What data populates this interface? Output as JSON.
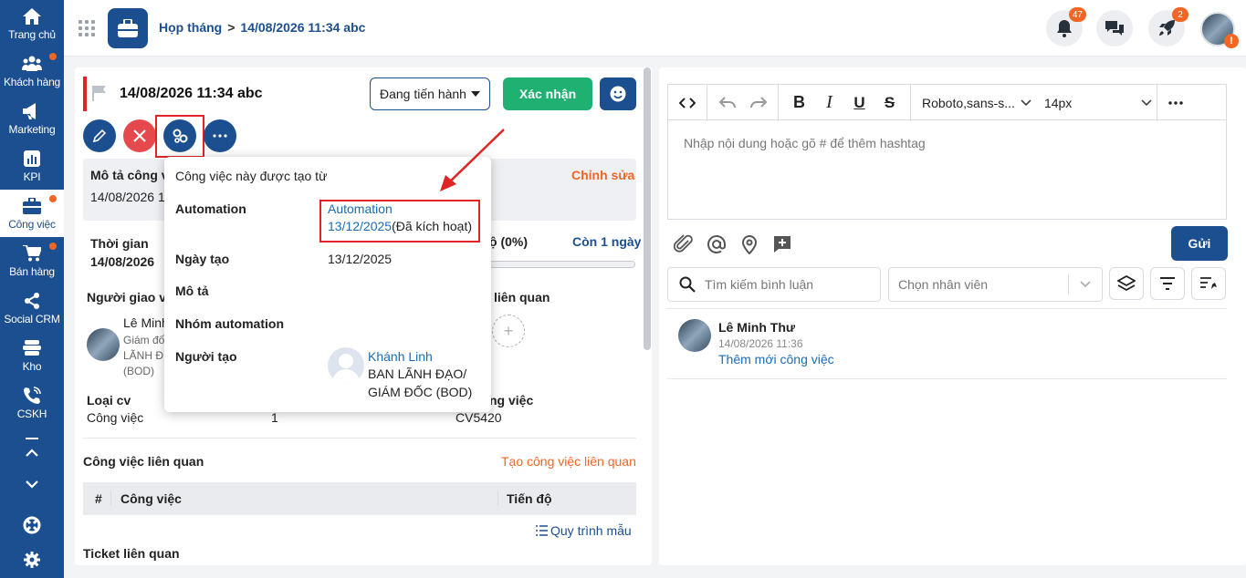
{
  "sidebar": {
    "items": [
      {
        "label": "Trang chủ",
        "icon": "home-icon"
      },
      {
        "label": "Khách hàng",
        "icon": "users-icon"
      },
      {
        "label": "Marketing",
        "icon": "megaphone-icon"
      },
      {
        "label": "KPI",
        "icon": "chart-icon"
      },
      {
        "label": "Công việc",
        "icon": "briefcase-icon"
      },
      {
        "label": "Bán hàng",
        "icon": "cart-icon"
      },
      {
        "label": "Social CRM",
        "icon": "share-icon"
      },
      {
        "label": "Kho",
        "icon": "warehouse-icon"
      },
      {
        "label": "CSKH",
        "icon": "phone-icon"
      }
    ]
  },
  "header": {
    "breadcrumb_parent": "Họp tháng",
    "breadcrumb_sep": ">",
    "breadcrumb_current": "14/08/2026 11:34 abc",
    "notif_count": "47",
    "rocket_count": "2",
    "warn_symbol": "!"
  },
  "task": {
    "title": "14/08/2026 11:34 abc",
    "status": "Đang tiến hành",
    "confirm_label": "Xác nhận",
    "desc_label": "Mô tả công v",
    "desc_value": "14/08/2026 1",
    "edit_link": "Chỉnh sửa",
    "time_label": "Thời gian",
    "time_value": "14/08/2026",
    "progress_label": "ộ (0%)",
    "progress_value": 0,
    "remaining": "Còn 1 ngày",
    "assigner_label": "Người giao vi",
    "related_label": "liên quan",
    "assigner_name": "Lê Minh",
    "assigner_role1": "Giám đố",
    "assigner_role2": "LÃNH Đ",
    "assigner_role3": "(BOD)",
    "type_label": "Loại cv",
    "type_value": "Công việc",
    "priority_value": "1",
    "code_label": "ng việc",
    "code_value": "CV5420",
    "related_tasks_title": "Công việc liên quan",
    "create_related": "Tạo công việc liên quan",
    "table_cols": [
      "#",
      "Công việc",
      "Tiến độ"
    ],
    "workflow_link": "Quy trình mẫu",
    "ticket_title": "Ticket liên quan"
  },
  "popup": {
    "heading": "Công việc này được tạo từ",
    "automation_label": "Automation",
    "automation_line1": "Automation",
    "automation_date": "13/12/2025",
    "automation_status": "(Đã kích hoạt)",
    "created_label": "Ngày tạo",
    "created_value": "13/12/2025",
    "desc_label": "Mô tả",
    "group_label": "Nhóm automation",
    "creator_label": "Người tạo",
    "creator_name": "Khánh Linh",
    "creator_dept1": "BAN LÃNH ĐẠO/",
    "creator_dept2": "GIÁM ĐỐC (BOD)"
  },
  "comment_panel": {
    "font": "Roboto,sans-s...",
    "size": "14px",
    "editor_placeholder": "Nhập nội dung hoặc gõ # để thêm hashtag",
    "send_label": "Gửi",
    "search_placeholder": "Tìm kiếm bình luận",
    "staff_placeholder": "Chọn nhân viên",
    "comments": [
      {
        "author": "Lê Minh Thư",
        "time": "14/08/2026 11:36",
        "text": "Thêm mới công việc"
      }
    ]
  },
  "colors": {
    "brand": "#1b4f8f",
    "accent": "#f26522",
    "success": "#1fb171",
    "danger": "#e02424"
  }
}
